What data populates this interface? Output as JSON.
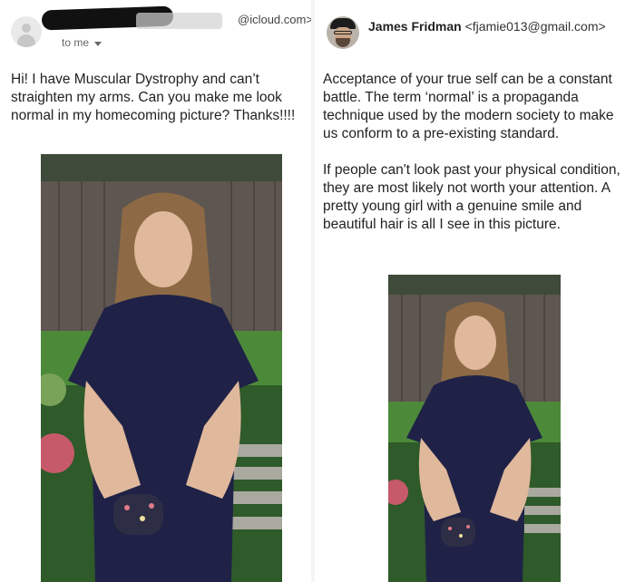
{
  "left_email": {
    "sender_email": "@icloud.com>",
    "recipient": "to me",
    "body": "Hi! I have Muscular Dystrophy and can’t straighten my arms. Can you make me look normal in my homecoming picture? Thanks!!!!"
  },
  "right_email": {
    "sender_name": "James Fridman",
    "sender_address": "<fjamie013@gmail.com>",
    "paragraph1": "Acceptance of your true self can be a constant battle. The term ‘normal’ is a propaganda technique used by the modern society to make us conform to a pre-existing standard.",
    "paragraph2": "If people can't look past your physical condition, they are most likely not worth your attention. A pretty young girl with a genuine smile and beautiful hair is all I see in this picture."
  },
  "icons": {
    "left_avatar": "person-placeholder-icon",
    "expand": "chevron-down-icon",
    "right_avatar": "profile-photo"
  },
  "colors": {
    "text": "#222222",
    "muted": "#666666",
    "redaction": "#111111",
    "dress": "#1f2246",
    "fence": "#5e5650"
  }
}
